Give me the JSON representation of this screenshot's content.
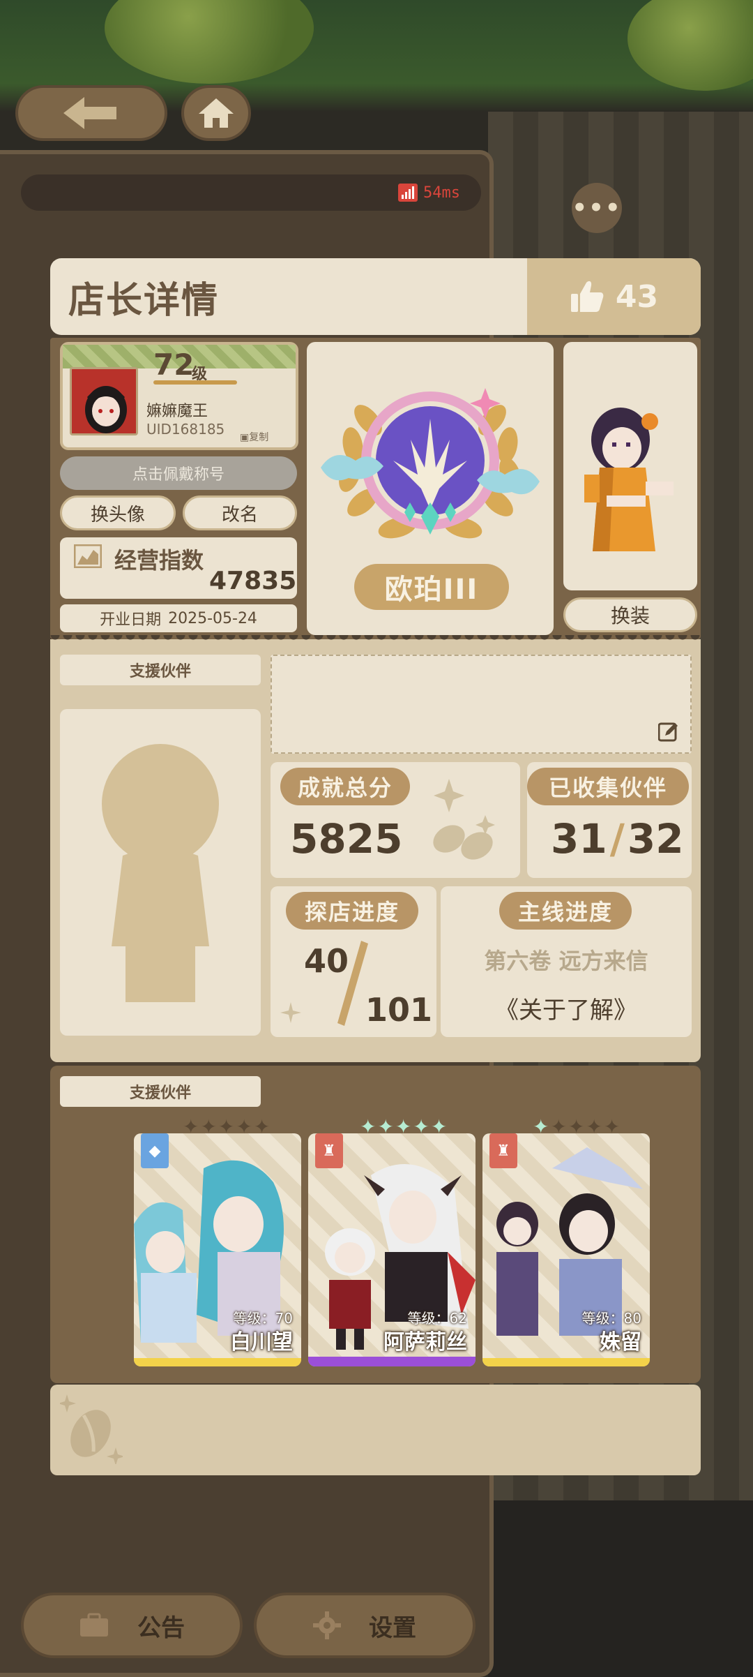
{
  "header": {
    "title": "店长详情",
    "likes": "43"
  },
  "status": {
    "ping": "54ms"
  },
  "profile": {
    "level": "72",
    "level_unit": "级",
    "name": "嫲嫲魔王",
    "uid": "UID168185",
    "copy_label": "复制",
    "wear_title_label": "点击佩戴称号",
    "change_avatar_label": "换头像",
    "rename_label": "改名",
    "business_index_label": "经营指数",
    "business_index_value": "47835",
    "open_date_label": "开业日期",
    "open_date_value": "2025-05-24",
    "rank": "欧珀III",
    "change_outfit_label": "换装"
  },
  "support": {
    "section_label": "支援伙伴",
    "achievement_label": "成就总分",
    "achievement_value": "5825",
    "collected_label": "已收集伙伴",
    "collected_value": "31",
    "collected_total": "32",
    "explore_label": "探店进度",
    "explore_value": "40",
    "explore_total": "101",
    "mainline_label": "主线进度",
    "mainline_chapter": "第六卷 远方来信",
    "mainline_subtitle": "《关于了解》"
  },
  "partners": {
    "section_label": "支援伙伴",
    "items": [
      {
        "name": "白川望",
        "level": "等级：70",
        "stars_filled": 0,
        "class_color": "#6aa4e0",
        "strip_color": "#f3d24a"
      },
      {
        "name": "阿萨莉丝",
        "level": "等级：62",
        "stars_filled": 5,
        "class_color": "#d96a5a",
        "strip_color": "#9b4fd8"
      },
      {
        "name": "姝留",
        "level": "等级：80",
        "stars_filled": 1,
        "class_color": "#d96a5a",
        "strip_color": "#f3d24a"
      }
    ]
  },
  "bottom": {
    "notice_label": "公告",
    "settings_label": "设置"
  },
  "colors": {
    "panel_bg": "#ece3d1",
    "accent_tan": "#b89566",
    "ping_red": "#d9453b"
  }
}
